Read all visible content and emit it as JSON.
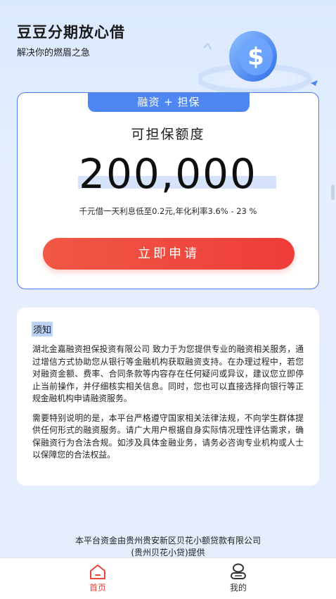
{
  "header": {
    "title": "豆豆分期放心借",
    "subtitle": "解决你的燃眉之急",
    "hero_icon": "dollar-coin-icon"
  },
  "loan_card": {
    "tag": "融资 + 担保",
    "label": "可担保额度",
    "amount": "200,000",
    "rate_note": "千元借一天利息低至0.2元,年化利率3.6% - 23 %",
    "apply_button": "立即申请",
    "accent_color": "#4f87f2",
    "button_color": "#ef4a3e"
  },
  "notice": {
    "title": "须知",
    "paragraphs": [
      "湖北金嘉融资担保投资有限公司 致力于为您提供专业的融资相关服务，通过增信方式协助您从银行等金融机构获取融资支持。在办理过程中，若您对融资金额、费率、合同条款等内容存在任何疑问或异议，建议您立即停止当前操作，并仔细核实相关信息。同时，您也可以直接选择向银行等正规金融机构申请融资服务。",
      "需要特别说明的是，本平台严格遵守国家相关法律法规，不向学生群体提供任何形式的融资服务。请广大用户根据自身实际情况理性评估需求，确保融资行为合法合规。如涉及具体金融业务，请务必咨询专业机构或人士以保障您的合法权益。"
    ]
  },
  "footer": {
    "line1": "本平台资金由贵州贵安新区贝花小额贷款有限公司",
    "line2": "(贵州贝花小贷)提供"
  },
  "tabbar": {
    "tabs": [
      {
        "label": "首页",
        "icon": "home-icon",
        "active": true
      },
      {
        "label": "我的",
        "icon": "user-icon",
        "active": false
      }
    ]
  }
}
